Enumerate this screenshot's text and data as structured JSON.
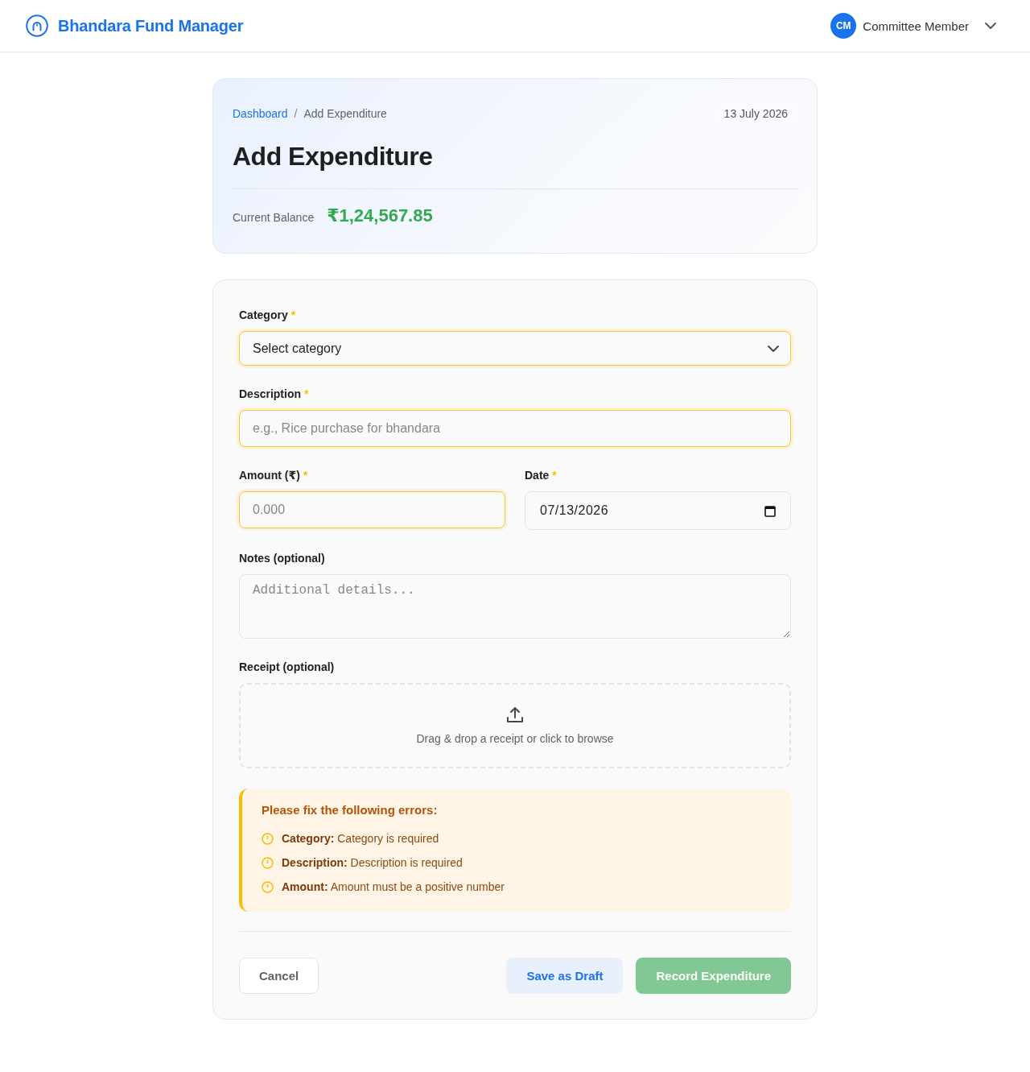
{
  "header": {
    "app_name": "Bhandara Fund Manager",
    "user": {
      "initials": "CM",
      "name": "Committee Member"
    }
  },
  "summary": {
    "breadcrumb": [
      {
        "label": "Dashboard",
        "kind": "link"
      },
      {
        "label": "Add Expenditure",
        "kind": "current"
      }
    ],
    "separator": "/",
    "date": "13 July 2026",
    "title": "Add Expenditure",
    "balance_label": "Current Balance",
    "balance": "₹1,24,567.85"
  },
  "form": {
    "rows": [
      {
        "fields": [
          {
            "kind": "select",
            "label": "Category",
            "required_mark": "*",
            "value": "Select category",
            "invalid": true
          }
        ]
      },
      {
        "fields": [
          {
            "kind": "text",
            "label": "Description",
            "required_mark": "*",
            "placeholder": "e.g., Rice purchase for bhandara",
            "invalid": true
          }
        ]
      },
      {
        "fields": [
          {
            "kind": "number",
            "label": "Amount (₹)",
            "required_mark": "*",
            "placeholder": "0.000",
            "invalid": true
          },
          {
            "kind": "date",
            "label": "Date",
            "required_mark": "*",
            "value": "07/13/2026",
            "invalid": false
          }
        ]
      },
      {
        "fields": [
          {
            "kind": "textarea",
            "label": "Notes (optional)",
            "placeholder": "Additional details...",
            "invalid": false
          }
        ]
      },
      {
        "fields": [
          {
            "kind": "upload",
            "label": "Receipt (optional)",
            "hint": "Drag & drop a receipt or click to browse",
            "invalid": false
          }
        ]
      }
    ],
    "errors": {
      "title": "Please fix the following errors:",
      "items": [
        "**Category:** Category is required",
        "**Description:** Description is required",
        "**Amount:** Amount must be a positive number"
      ]
    },
    "buttons": [
      {
        "label": "Cancel",
        "kind": "secondary",
        "disabled": false
      },
      {
        "label": "Save as Draft",
        "kind": "soft",
        "disabled": false
      },
      {
        "label": "Record Expenditure",
        "kind": "primary",
        "disabled": true
      }
    ]
  }
}
